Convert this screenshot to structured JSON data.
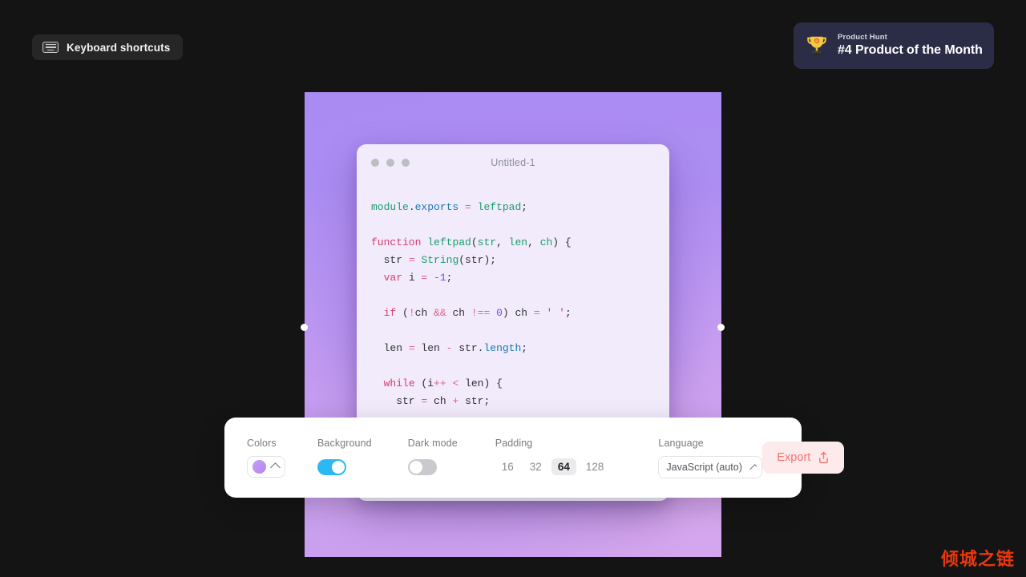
{
  "topbar": {
    "keyboard_shortcuts_label": "Keyboard shortcuts",
    "keyboard_icon": "keyboard-icon"
  },
  "badge": {
    "kicker": "Product Hunt",
    "title": "#4 Product of the Month",
    "icon": "trophy-icon",
    "background_color": "#2b2d47",
    "trophy_color": "#f5cb3e"
  },
  "canvas": {
    "background_gradient_colors": [
      "#a98bf2",
      "#ae8ef2",
      "#c79ced",
      "#cfa3ef"
    ],
    "left_handle": "resize-handle-left",
    "right_handle": "resize-handle-right"
  },
  "code_window": {
    "title": "Untitled-1",
    "dot_color": "#bdbdc4",
    "surface_color": "#f1ebfb",
    "code_lines": [
      [
        {
          "t": "module",
          "c": "tok-fn"
        },
        {
          "t": ".",
          "c": "tok-plain"
        },
        {
          "t": "exports",
          "c": "tok-prop"
        },
        {
          "t": " ",
          "c": "tok-plain"
        },
        {
          "t": "=",
          "c": "tok-op"
        },
        {
          "t": " ",
          "c": "tok-plain"
        },
        {
          "t": "leftpad",
          "c": "tok-fn"
        },
        {
          "t": ";",
          "c": "tok-plain"
        }
      ],
      [],
      [
        {
          "t": "function",
          "c": "tok-kw"
        },
        {
          "t": " ",
          "c": "tok-plain"
        },
        {
          "t": "leftpad",
          "c": "tok-fn"
        },
        {
          "t": "(",
          "c": "tok-plain"
        },
        {
          "t": "str",
          "c": "tok-fn"
        },
        {
          "t": ", ",
          "c": "tok-plain"
        },
        {
          "t": "len",
          "c": "tok-fn"
        },
        {
          "t": ", ",
          "c": "tok-plain"
        },
        {
          "t": "ch",
          "c": "tok-fn"
        },
        {
          "t": ") {",
          "c": "tok-plain"
        }
      ],
      [
        {
          "t": "  str ",
          "c": "tok-plain"
        },
        {
          "t": "=",
          "c": "tok-op"
        },
        {
          "t": " ",
          "c": "tok-plain"
        },
        {
          "t": "String",
          "c": "tok-fn"
        },
        {
          "t": "(str);",
          "c": "tok-plain"
        }
      ],
      [
        {
          "t": "  ",
          "c": "tok-plain"
        },
        {
          "t": "var",
          "c": "tok-kw"
        },
        {
          "t": " i ",
          "c": "tok-plain"
        },
        {
          "t": "=",
          "c": "tok-op"
        },
        {
          "t": " ",
          "c": "tok-plain"
        },
        {
          "t": "-1",
          "c": "tok-num"
        },
        {
          "t": ";",
          "c": "tok-plain"
        }
      ],
      [],
      [
        {
          "t": "  ",
          "c": "tok-plain"
        },
        {
          "t": "if",
          "c": "tok-kw"
        },
        {
          "t": " (",
          "c": "tok-plain"
        },
        {
          "t": "!",
          "c": "tok-op"
        },
        {
          "t": "ch ",
          "c": "tok-plain"
        },
        {
          "t": "&&",
          "c": "tok-op"
        },
        {
          "t": " ch ",
          "c": "tok-plain"
        },
        {
          "t": "!==",
          "c": "tok-op"
        },
        {
          "t": " ",
          "c": "tok-plain"
        },
        {
          "t": "0",
          "c": "tok-num"
        },
        {
          "t": ") ch ",
          "c": "tok-plain"
        },
        {
          "t": "=",
          "c": "tok-op"
        },
        {
          "t": " ",
          "c": "tok-plain"
        },
        {
          "t": "' '",
          "c": "tok-str"
        },
        {
          "t": ";",
          "c": "tok-plain"
        }
      ],
      [],
      [
        {
          "t": "  len ",
          "c": "tok-plain"
        },
        {
          "t": "=",
          "c": "tok-op"
        },
        {
          "t": " len ",
          "c": "tok-plain"
        },
        {
          "t": "-",
          "c": "tok-op"
        },
        {
          "t": " str.",
          "c": "tok-plain"
        },
        {
          "t": "length",
          "c": "tok-prop"
        },
        {
          "t": ";",
          "c": "tok-plain"
        }
      ],
      [],
      [
        {
          "t": "  ",
          "c": "tok-plain"
        },
        {
          "t": "while",
          "c": "tok-kw"
        },
        {
          "t": " (i",
          "c": "tok-plain"
        },
        {
          "t": "++",
          "c": "tok-op"
        },
        {
          "t": " ",
          "c": "tok-plain"
        },
        {
          "t": "<",
          "c": "tok-op"
        },
        {
          "t": " len) {",
          "c": "tok-plain"
        }
      ],
      [
        {
          "t": "    str ",
          "c": "tok-plain"
        },
        {
          "t": "=",
          "c": "tok-op"
        },
        {
          "t": " ch ",
          "c": "tok-plain"
        },
        {
          "t": "+",
          "c": "tok-op"
        },
        {
          "t": " str;",
          "c": "tok-plain"
        }
      ]
    ]
  },
  "toolbar": {
    "colors": {
      "label": "Colors",
      "swatch_color": "#bd93f0",
      "chevron": "chevron-up-icon"
    },
    "background": {
      "label": "Background",
      "enabled": true,
      "on_color": "#2bb8f5"
    },
    "dark_mode": {
      "label": "Dark mode",
      "enabled": false,
      "off_color": "#c9c9ce"
    },
    "padding": {
      "label": "Padding",
      "options": [
        "16",
        "32",
        "64",
        "128"
      ],
      "selected": "64"
    },
    "language": {
      "label": "Language",
      "value": "JavaScript (auto)",
      "chevron": "chevron-up-icon"
    },
    "export": {
      "label": "Export",
      "icon": "share-export-icon",
      "text_color": "#f4736f",
      "background_color": "#fdeaea"
    }
  },
  "watermark": {
    "text": "倾城之链",
    "color": "#e8380d"
  }
}
